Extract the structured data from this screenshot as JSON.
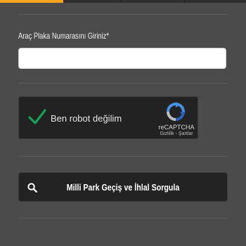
{
  "form": {
    "plate_label": "Araç Plaka Numarasını Giriniz*",
    "plate_value": "",
    "plate_placeholder": ""
  },
  "recaptcha": {
    "checkbox_label": "Ben robot değilim",
    "brand": "reCAPTCHA",
    "privacy_link": "Gizlilik",
    "separator": " - ",
    "terms_link": "Şartlar",
    "icons": {
      "check": "check-icon",
      "logo": "recaptcha-logo-icon"
    }
  },
  "query": {
    "button_label": "Milli Park Geçiş ve İhlal Sorgula",
    "icon": "search-icon"
  },
  "colors": {
    "page_bg": "#4b4b4b",
    "accent": "#f5a31f",
    "check_green": "#17a057",
    "button_bg": "#232323"
  }
}
